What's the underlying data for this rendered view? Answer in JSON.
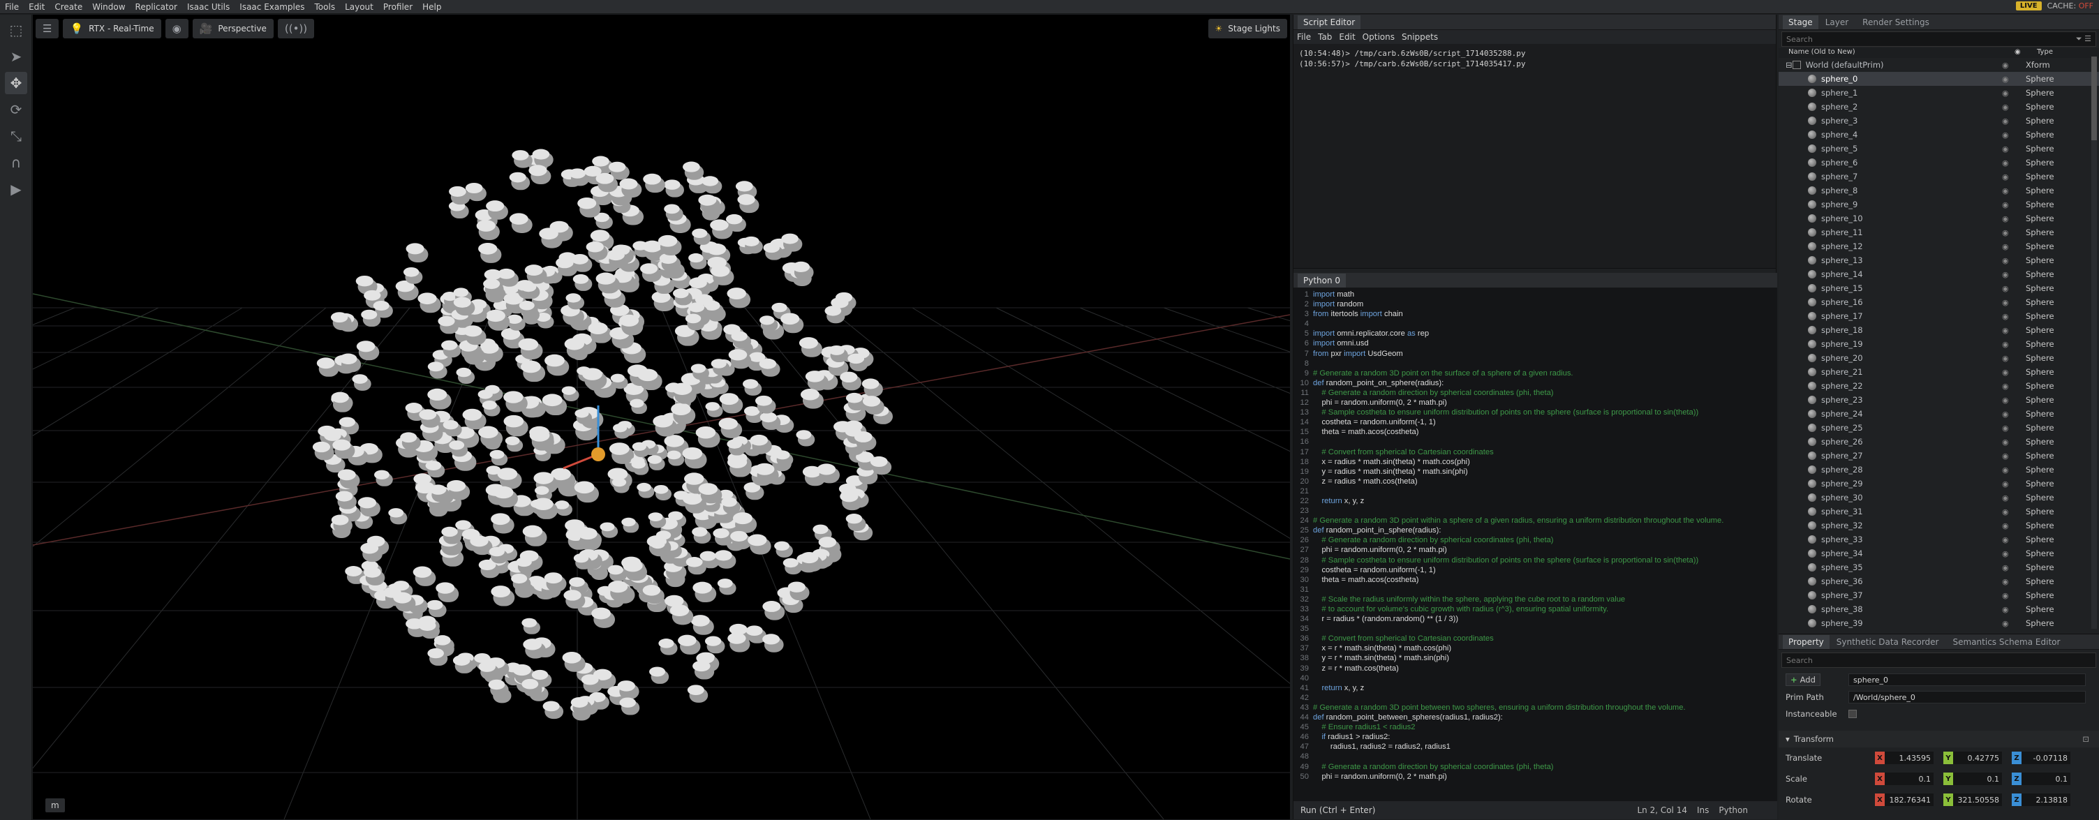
{
  "menu": [
    "File",
    "Edit",
    "Create",
    "Window",
    "Replicator",
    "Isaac Utils",
    "Isaac Examples",
    "Tools",
    "Layout",
    "Profiler",
    "Help"
  ],
  "status_right": {
    "live": "LIVE",
    "cache": "CACHE:",
    "cache_state": "OFF"
  },
  "viewport": {
    "render_mode": "RTX - Real-Time",
    "camera": "Perspective",
    "stage_lights": "Stage Lights",
    "bottom_label": "m"
  },
  "script_editor": {
    "title": "Script Editor",
    "menu": [
      "File",
      "Tab",
      "Edit",
      "Options",
      "Snippets"
    ],
    "log": [
      "(10:54:48)> /tmp/carb.6zWs0B/script_1714035288.py",
      "(10:56:57)> /tmp/carb.6zWs0B/script_1714035417.py"
    ],
    "tab": "Python 0",
    "code": [
      {
        "n": 1,
        "t": "import math",
        "c": false
      },
      {
        "n": 2,
        "t": "import random",
        "c": false
      },
      {
        "n": 3,
        "t": "from itertools import chain",
        "c": false
      },
      {
        "n": 4,
        "t": "",
        "c": false
      },
      {
        "n": 5,
        "t": "import omni.replicator.core as rep",
        "c": false
      },
      {
        "n": 6,
        "t": "import omni.usd",
        "c": false
      },
      {
        "n": 7,
        "t": "from pxr import UsdGeom",
        "c": false
      },
      {
        "n": 8,
        "t": "",
        "c": false
      },
      {
        "n": 9,
        "t": "# Generate a random 3D point on the surface of a sphere of a given radius.",
        "c": true
      },
      {
        "n": 10,
        "t": "def random_point_on_sphere(radius):",
        "c": false
      },
      {
        "n": 11,
        "t": "    # Generate a random direction by spherical coordinates (phi, theta)",
        "c": true
      },
      {
        "n": 12,
        "t": "    phi = random.uniform(0, 2 * math.pi)",
        "c": false
      },
      {
        "n": 13,
        "t": "    # Sample costheta to ensure uniform distribution of points on the sphere (surface is proportional to sin(theta))",
        "c": true
      },
      {
        "n": 14,
        "t": "    costheta = random.uniform(-1, 1)",
        "c": false
      },
      {
        "n": 15,
        "t": "    theta = math.acos(costheta)",
        "c": false
      },
      {
        "n": 16,
        "t": "",
        "c": false
      },
      {
        "n": 17,
        "t": "    # Convert from spherical to Cartesian coordinates",
        "c": true
      },
      {
        "n": 18,
        "t": "    x = radius * math.sin(theta) * math.cos(phi)",
        "c": false
      },
      {
        "n": 19,
        "t": "    y = radius * math.sin(theta) * math.sin(phi)",
        "c": false
      },
      {
        "n": 20,
        "t": "    z = radius * math.cos(theta)",
        "c": false
      },
      {
        "n": 21,
        "t": "",
        "c": false
      },
      {
        "n": 22,
        "t": "    return x, y, z",
        "c": false
      },
      {
        "n": 23,
        "t": "",
        "c": false
      },
      {
        "n": 24,
        "t": "# Generate a random 3D point within a sphere of a given radius, ensuring a uniform distribution throughout the volume.",
        "c": true
      },
      {
        "n": 25,
        "t": "def random_point_in_sphere(radius):",
        "c": false
      },
      {
        "n": 26,
        "t": "    # Generate a random direction by spherical coordinates (phi, theta)",
        "c": true
      },
      {
        "n": 27,
        "t": "    phi = random.uniform(0, 2 * math.pi)",
        "c": false
      },
      {
        "n": 28,
        "t": "    # Sample costheta to ensure uniform distribution of points on the sphere (surface is proportional to sin(theta))",
        "c": true
      },
      {
        "n": 29,
        "t": "    costheta = random.uniform(-1, 1)",
        "c": false
      },
      {
        "n": 30,
        "t": "    theta = math.acos(costheta)",
        "c": false
      },
      {
        "n": 31,
        "t": "",
        "c": false
      },
      {
        "n": 32,
        "t": "    # Scale the radius uniformly within the sphere, applying the cube root to a random value",
        "c": true
      },
      {
        "n": 33,
        "t": "    # to account for volume's cubic growth with radius (r^3), ensuring spatial uniformity.",
        "c": true
      },
      {
        "n": 34,
        "t": "    r = radius * (random.random() ** (1 / 3))",
        "c": false
      },
      {
        "n": 35,
        "t": "",
        "c": false
      },
      {
        "n": 36,
        "t": "    # Convert from spherical to Cartesian coordinates",
        "c": true
      },
      {
        "n": 37,
        "t": "    x = r * math.sin(theta) * math.cos(phi)",
        "c": false
      },
      {
        "n": 38,
        "t": "    y = r * math.sin(theta) * math.sin(phi)",
        "c": false
      },
      {
        "n": 39,
        "t": "    z = r * math.cos(theta)",
        "c": false
      },
      {
        "n": 40,
        "t": "",
        "c": false
      },
      {
        "n": 41,
        "t": "    return x, y, z",
        "c": false
      },
      {
        "n": 42,
        "t": "",
        "c": false
      },
      {
        "n": 43,
        "t": "# Generate a random 3D point between two spheres, ensuring a uniform distribution throughout the volume.",
        "c": true
      },
      {
        "n": 44,
        "t": "def random_point_between_spheres(radius1, radius2):",
        "c": false
      },
      {
        "n": 45,
        "t": "    # Ensure radius1 < radius2",
        "c": true
      },
      {
        "n": 46,
        "t": "    if radius1 > radius2:",
        "c": false
      },
      {
        "n": 47,
        "t": "        radius1, radius2 = radius2, radius1",
        "c": false
      },
      {
        "n": 48,
        "t": "",
        "c": false
      },
      {
        "n": 49,
        "t": "    # Generate a random direction by spherical coordinates (phi, theta)",
        "c": true
      },
      {
        "n": 50,
        "t": "    phi = random.uniform(0, 2 * math.pi)",
        "c": false
      }
    ],
    "run": "Run (Ctrl + Enter)",
    "cursor": "Ln 2, Col 14",
    "mode": "Ins",
    "lang": "Python"
  },
  "stage": {
    "tabs": [
      "Stage",
      "Layer",
      "Render Settings"
    ],
    "search_placeholder": "Search",
    "col_name": "Name (Old to New)",
    "col_type": "Type",
    "root": {
      "name": "World (defaultPrim)",
      "type": "Xform"
    },
    "prims": [
      "sphere_0",
      "sphere_1",
      "sphere_2",
      "sphere_3",
      "sphere_4",
      "sphere_5",
      "sphere_6",
      "sphere_7",
      "sphere_8",
      "sphere_9",
      "sphere_10",
      "sphere_11",
      "sphere_12",
      "sphere_13",
      "sphere_14",
      "sphere_15",
      "sphere_16",
      "sphere_17",
      "sphere_18",
      "sphere_19",
      "sphere_20",
      "sphere_21",
      "sphere_22",
      "sphere_23",
      "sphere_24",
      "sphere_25",
      "sphere_26",
      "sphere_27",
      "sphere_28",
      "sphere_29",
      "sphere_30",
      "sphere_31",
      "sphere_32",
      "sphere_33",
      "sphere_34",
      "sphere_35",
      "sphere_36",
      "sphere_37",
      "sphere_38",
      "sphere_39"
    ],
    "prim_type": "Sphere",
    "selected": "sphere_0"
  },
  "property": {
    "tabs": [
      "Property",
      "Synthetic Data Recorder",
      "Semantics Schema Editor"
    ],
    "search_placeholder": "Search",
    "add": "Add",
    "name_value": "sphere_0",
    "prim_path_label": "Prim Path",
    "prim_path": "/World/sphere_0",
    "instanceable_label": "Instanceable",
    "transform_label": "Transform",
    "translate_label": "Translate",
    "translate": [
      "1.43595",
      "0.42775",
      "-0.07118"
    ],
    "scale_label": "Scale",
    "scale": [
      "0.1",
      "0.1",
      "0.1"
    ],
    "rotate_label": "Rotate",
    "rotate": [
      "182.76341",
      "321.50558",
      "2.13818"
    ]
  }
}
